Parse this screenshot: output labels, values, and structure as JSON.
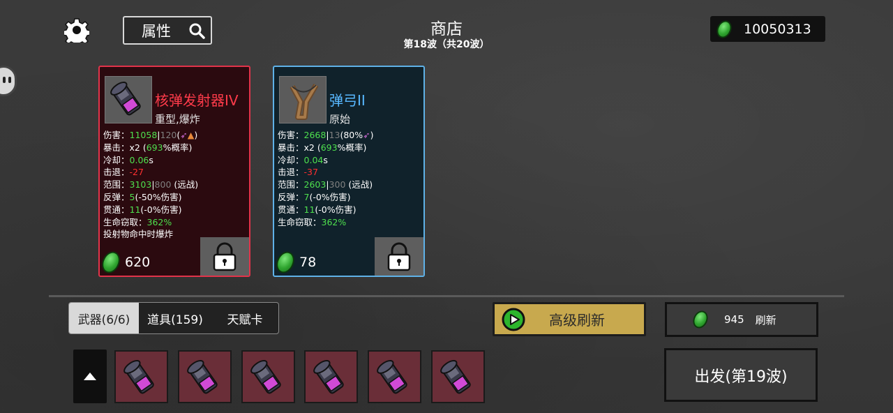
{
  "header": {
    "title": "商店",
    "subtitle": "第18波（共20波）",
    "attr_button": "属性",
    "money": "10050313"
  },
  "cards": [
    {
      "name": "核弹发射器IV",
      "tags": "重型,爆炸",
      "price": "620",
      "stats": {
        "dmg_label": "伤害：",
        "dmg_val": "11058",
        "dmg_sep": "|",
        "dmg_sub": "120",
        "dmg_tail": "(",
        "dmg_close": ")",
        "crit_label": "暴击：",
        "crit_x": "x2 (",
        "crit_val": "693",
        "crit_tail": "%概率)",
        "cd_label": "冷却：",
        "cd_val": "0.06",
        "cd_unit": "s",
        "kb_label": "击退：",
        "kb_val": "-27",
        "range_label": "范围：",
        "range_val": "3103",
        "range_sep": "|",
        "range_sub": "800",
        "range_tail": " (远战)",
        "bounce_label": "反弹：",
        "bounce_val": "5",
        "bounce_tail": "(-50%伤害)",
        "pierce_label": "贯通：",
        "pierce_val": "11",
        "pierce_tail": "(-0%伤害)",
        "steal_label": "生命窃取：",
        "steal_val": "362%",
        "extra": "投射物命中时爆炸"
      }
    },
    {
      "name": "弹弓II",
      "tags": "原始",
      "price": "78",
      "stats": {
        "dmg_label": "伤害：",
        "dmg_val": "2668",
        "dmg_sep": "|",
        "dmg_sub": "13",
        "dmg_tail": "(80%",
        "dmg_close": ")",
        "crit_label": "暴击：",
        "crit_x": "x2 (",
        "crit_val": "693",
        "crit_tail": "%概率)",
        "cd_label": "冷却：",
        "cd_val": "0.04",
        "cd_unit": "s",
        "kb_label": "击退：",
        "kb_val": "-37",
        "range_label": "范围：",
        "range_val": "2603",
        "range_sep": "|",
        "range_sub": "300",
        "range_tail": " (远战)",
        "bounce_label": "反弹：",
        "bounce_val": "7",
        "bounce_tail": "(-0%伤害)",
        "pierce_label": "贯通：",
        "pierce_val": "11",
        "pierce_tail": "(-0%伤害)",
        "steal_label": "生命窃取：",
        "steal_val": "362%"
      }
    }
  ],
  "tabs": [
    "武器(6/6)",
    "道具(159)",
    "天赋卡"
  ],
  "adv_refresh": "高级刷新",
  "refresh": {
    "cost": "945",
    "label": "刷新"
  },
  "go_button": "出发(第19波)",
  "inventory_slots": [
    "nuke-launcher",
    "nuke-launcher",
    "nuke-launcher",
    "nuke-launcher",
    "nuke-launcher",
    "nuke-launcher"
  ],
  "colors": {
    "card_red_border": "#e2334a",
    "card_blue_border": "#5fb2e8",
    "accent_gold": "#c8a94e",
    "stat_green": "#4ee04e",
    "stat_red": "#ff3030"
  }
}
